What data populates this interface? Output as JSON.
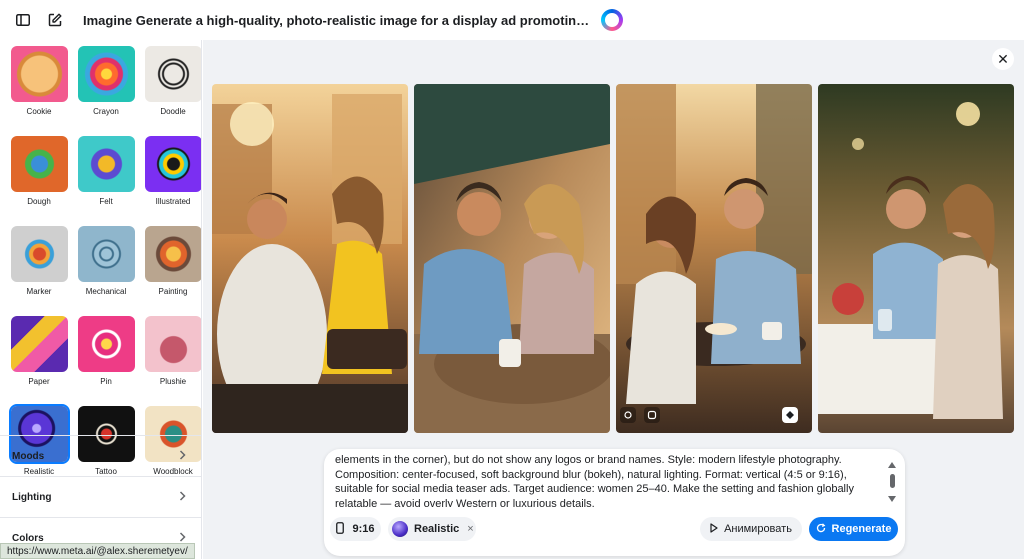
{
  "header": {
    "title": "Imagine Generate a high-quality, photo-realistic image for a display ad promoting a dating app. The...",
    "icons": [
      "sidebar-toggle-icon",
      "new-chat-icon",
      "meta-ai-logo"
    ]
  },
  "styles": [
    {
      "label": "Cookie",
      "icon": "cookie-style-thumb"
    },
    {
      "label": "Crayon",
      "icon": "crayon-style-thumb"
    },
    {
      "label": "Doodle",
      "icon": "doodle-style-thumb"
    },
    {
      "label": "Dough",
      "icon": "dough-style-thumb"
    },
    {
      "label": "Felt",
      "icon": "felt-style-thumb"
    },
    {
      "label": "Illustrated",
      "icon": "illustrated-style-thumb"
    },
    {
      "label": "Marker",
      "icon": "marker-style-thumb"
    },
    {
      "label": "Mechanical",
      "icon": "mechanical-style-thumb"
    },
    {
      "label": "Painting",
      "icon": "painting-style-thumb"
    },
    {
      "label": "Paper",
      "icon": "paper-style-thumb"
    },
    {
      "label": "Pin",
      "icon": "pin-style-thumb"
    },
    {
      "label": "Plushie",
      "icon": "plushie-style-thumb"
    },
    {
      "label": "Realistic",
      "icon": "realistic-style-thumb",
      "selected": true
    },
    {
      "label": "Tattoo",
      "icon": "tattoo-style-thumb"
    },
    {
      "label": "Woodblock",
      "icon": "woodblock-style-thumb"
    }
  ],
  "accordions": [
    {
      "label": "Moods"
    },
    {
      "label": "Lighting"
    },
    {
      "label": "Colors"
    }
  ],
  "gallery": {
    "images": [
      {
        "alt_name": "generated-image-1"
      },
      {
        "alt_name": "generated-image-2"
      },
      {
        "alt_name": "generated-image-3"
      },
      {
        "alt_name": "generated-image-4"
      }
    ]
  },
  "prompt": {
    "text": "elements in the corner), but do not show any logos or brand names. Style: modern lifestyle photography. Composition: center-focused, soft background blur (bokeh), natural lighting. Format: vertical (4:5 or 9:16), suitable for social media teaser ads. Target audience: women 25–40. Make the setting and fashion globally relatable — avoid overly Western or luxurious details.",
    "ratio_label": "9:16",
    "style_label": "Realistic",
    "style_remove": "×",
    "animate_label": "Анимировать",
    "regenerate_label": "Regenerate"
  },
  "status_bar": {
    "url": "https://www.meta.ai/@alex.sheremetyev/"
  },
  "colors": {
    "accent": "#0a78f2",
    "selected_outline": "#0a7cff",
    "main_bg": "#f0f2f5"
  }
}
